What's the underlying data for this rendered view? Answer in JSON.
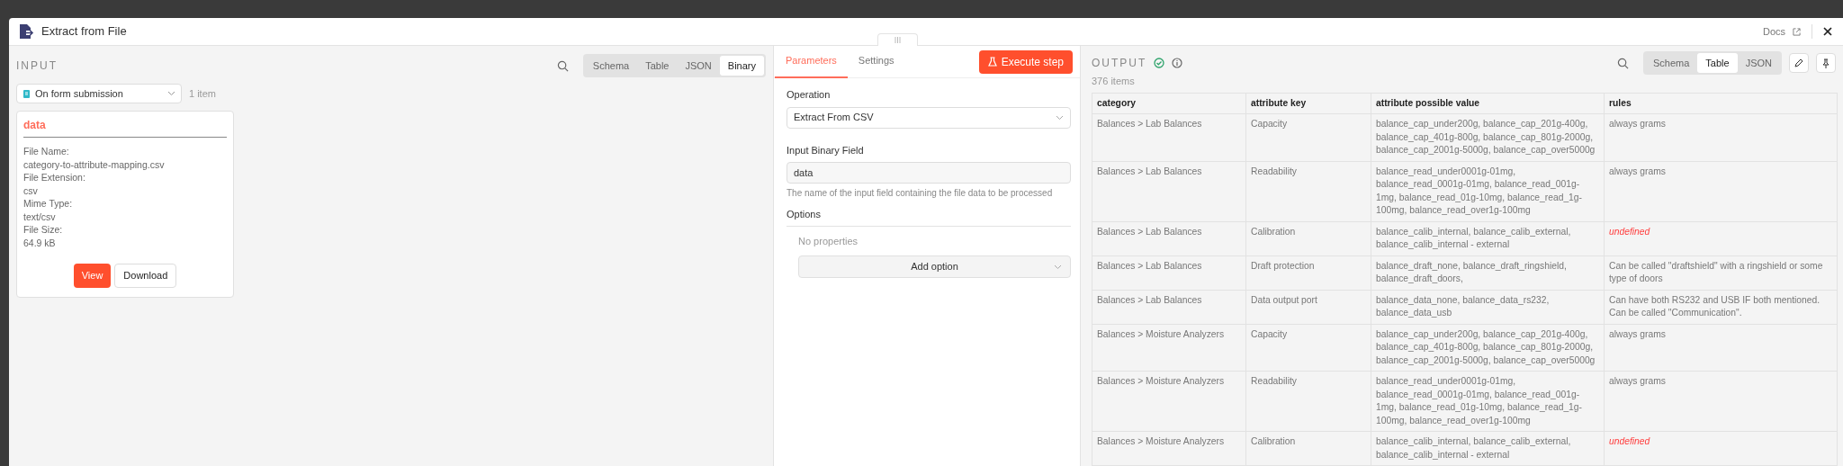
{
  "window": {
    "title": "Extract from File",
    "docs_link": "Docs"
  },
  "input": {
    "heading": "INPUT",
    "view_tabs": [
      {
        "label": "Schema",
        "selected": false
      },
      {
        "label": "Table",
        "selected": false
      },
      {
        "label": "JSON",
        "selected": false
      },
      {
        "label": "Binary",
        "selected": true
      }
    ],
    "source": {
      "value": "On form submission"
    },
    "item_count": "1 item",
    "binary": {
      "title": "data",
      "fields": [
        {
          "label": "File Name:",
          "value": "category-to-attribute-mapping.csv"
        },
        {
          "label": "File Extension:",
          "value": "csv"
        },
        {
          "label": "Mime Type:",
          "value": "text/csv"
        },
        {
          "label": "File Size:",
          "value": "64.9 kB"
        }
      ],
      "buttons": [
        {
          "label": "View",
          "kind": "primary"
        },
        {
          "label": "Download",
          "kind": "secondary"
        }
      ]
    }
  },
  "parameters": {
    "tabs": [
      {
        "label": "Parameters",
        "selected": true
      },
      {
        "label": "Settings",
        "selected": false
      }
    ],
    "execute_button": "Execute step",
    "operation": {
      "label": "Operation",
      "value": "Extract From CSV"
    },
    "binary_field": {
      "label": "Input Binary Field",
      "value": "data",
      "hint": "The name of the input field containing the file data to be processed"
    },
    "options": {
      "label": "Options",
      "empty_text": "No properties",
      "add_button": "Add option"
    }
  },
  "output": {
    "heading": "OUTPUT",
    "item_count": "376 items",
    "view_tabs": [
      {
        "label": "Schema",
        "selected": false
      },
      {
        "label": "Table",
        "selected": true
      },
      {
        "label": "JSON",
        "selected": false
      }
    ],
    "table": {
      "columns": [
        "category",
        "attribute key",
        "attribute possible value",
        "rules"
      ],
      "rows": [
        {
          "category": "Balances > Lab Balances",
          "attribute_key": "Capacity",
          "possible_value": "balance_cap_under200g, balance_cap_201g-400g, balance_cap_401g-800g, balance_cap_801g-2000g, balance_cap_2001g-5000g, balance_cap_over5000g",
          "rules": "always grams",
          "rules_undefined": false
        },
        {
          "category": "Balances > Lab Balances",
          "attribute_key": "Readability",
          "possible_value": "balance_read_under0001g-01mg, balance_read_0001g-01mg, balance_read_001g-1mg, balance_read_01g-10mg, balance_read_1g-100mg, balance_read_over1g-100mg",
          "rules": "always grams",
          "rules_undefined": false
        },
        {
          "category": "Balances > Lab Balances",
          "attribute_key": "Calibration",
          "possible_value": "balance_calib_internal, balance_calib_external, balance_calib_internal - external",
          "rules": "undefined",
          "rules_undefined": true
        },
        {
          "category": "Balances > Lab Balances",
          "attribute_key": "Draft protection",
          "possible_value": "balance_draft_none, balance_draft_ringshield, balance_draft_doors,",
          "rules": "Can be called \"draftshield\" with a ringshield or some type of doors",
          "rules_undefined": false
        },
        {
          "category": "Balances > Lab Balances",
          "attribute_key": "Data output port",
          "possible_value": "balance_data_none, balance_data_rs232, balance_data_usb",
          "rules": "Can have both RS232 and USB IF both mentioned. Can be called \"Communication\".",
          "rules_undefined": false
        },
        {
          "category": "Balances > Moisture Analyzers",
          "attribute_key": "Capacity",
          "possible_value": "balance_cap_under200g, balance_cap_201g-400g, balance_cap_401g-800g, balance_cap_801g-2000g, balance_cap_2001g-5000g, balance_cap_over5000g",
          "rules": "always grams",
          "rules_undefined": false
        },
        {
          "category": "Balances > Moisture Analyzers",
          "attribute_key": "Readability",
          "possible_value": "balance_read_under0001g-01mg, balance_read_0001g-01mg, balance_read_001g-1mg, balance_read_01g-10mg, balance_read_1g-100mg, balance_read_over1g-100mg",
          "rules": "always grams",
          "rules_undefined": false
        },
        {
          "category": "Balances > Moisture Analyzers",
          "attribute_key": "Calibration",
          "possible_value": "balance_calib_internal, balance_calib_external, balance_calib_internal - external",
          "rules": "undefined",
          "rules_undefined": true
        }
      ]
    }
  }
}
